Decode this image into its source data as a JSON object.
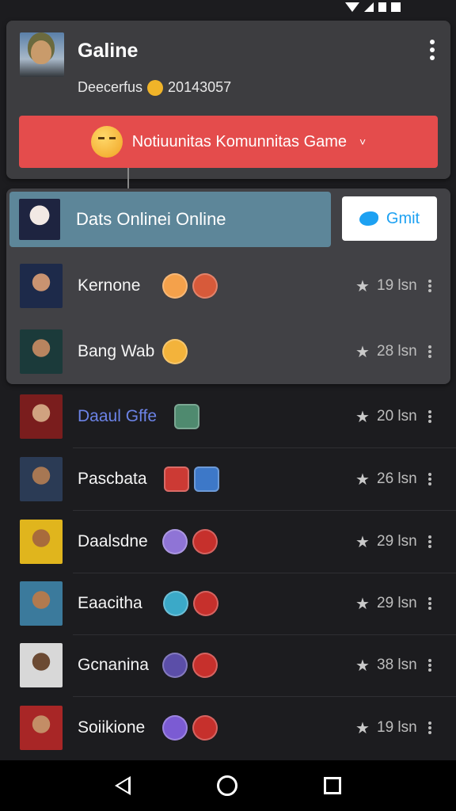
{
  "profile": {
    "name": "Galine",
    "subtitle_prefix": "Deecerfus",
    "subtitle_number": "20143057"
  },
  "community_button": {
    "label": "Notiuunitas Komunnitas Game",
    "chevron": "˅"
  },
  "online": {
    "label": "Dats Onlinei Online",
    "action_label": "Gmit"
  },
  "icons": {
    "star": "★"
  },
  "players": [
    {
      "name": "Kernone",
      "count": "19 lsn",
      "name_color": "#f4f4f4",
      "badges": [
        "#f4a14b",
        "#d75a3a"
      ]
    },
    {
      "name": "Bang Wab",
      "count": "28 lsn",
      "name_color": "#f4f4f4",
      "badges": [
        "#f3b33b"
      ]
    },
    {
      "name": "Daaul Gffe",
      "count": "20 lsn",
      "name_color": "#6c83e6",
      "badges": [
        "#4f8a6f"
      ]
    },
    {
      "name": "Pascbata",
      "count": "26 lsn",
      "name_color": "#f4f4f4",
      "badges": [
        "#cc3a34",
        "#3d78c8"
      ]
    },
    {
      "name": "Daalsdne",
      "count": "29 lsn",
      "name_color": "#f4f4f4",
      "badges": [
        "#8f74d6",
        "#c6302c"
      ]
    },
    {
      "name": "Eaacitha",
      "count": "29 lsn",
      "name_color": "#f4f4f4",
      "badges": [
        "#3ba9c8",
        "#c6302c"
      ]
    },
    {
      "name": "Gcnanina",
      "count": "38 lsn",
      "name_color": "#f4f4f4",
      "badges": [
        "#5b4ea8",
        "#c6302c"
      ]
    },
    {
      "name": "Soiikione",
      "count": "19 lsn",
      "name_color": "#f4f4f4",
      "badges": [
        "#7b5bd3",
        "#c6302c"
      ]
    }
  ],
  "colors": {
    "accent_red": "#e44c4c",
    "online_bar": "#5d8699",
    "twitter_blue": "#1da1f2"
  }
}
